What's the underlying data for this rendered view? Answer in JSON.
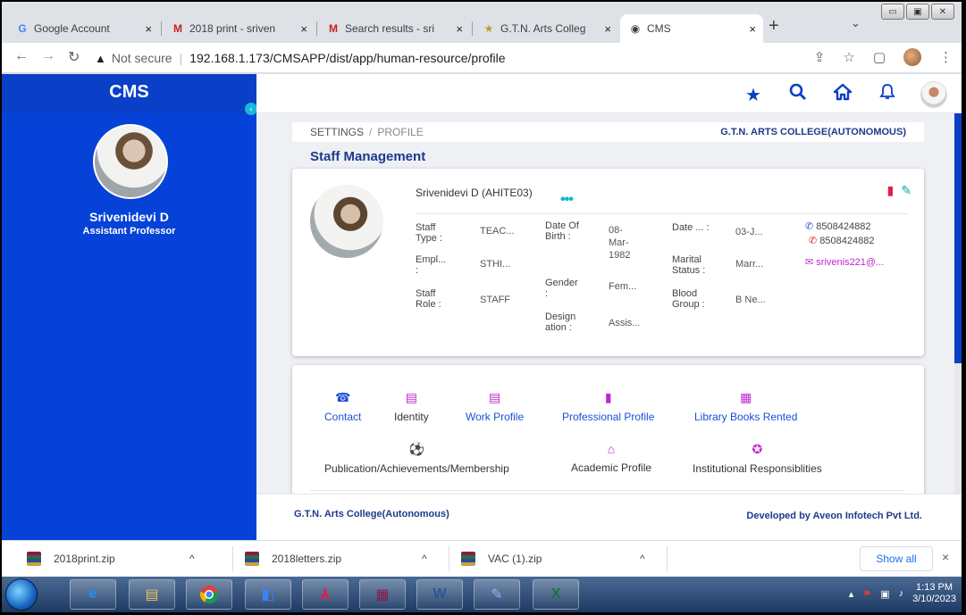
{
  "browser": {
    "tabs": [
      {
        "label": "Google Account",
        "favicon": "G",
        "color": "#4285f4"
      },
      {
        "label": "2018 print - sriven",
        "favicon": "M",
        "color": "#c5221f"
      },
      {
        "label": "Search results - sri",
        "favicon": "M",
        "color": "#c5221f"
      },
      {
        "label": "G.T.N. Arts Colleg",
        "favicon": "★",
        "color": "#c29a2a"
      },
      {
        "label": "CMS",
        "favicon": "◉",
        "color": "#3c4043"
      }
    ],
    "close_glyph": "×",
    "newtab_glyph": "+",
    "tabctrl_glyph": "⌄",
    "address": {
      "warning": "▲",
      "not_secure": "Not secure",
      "divider": "|",
      "url": "192.168.1.173/CMSAPP/dist/app/human-resource/profile"
    }
  },
  "app": {
    "brand": "CMS",
    "sidebar": {
      "name": "Srivenidevi D",
      "role": "Assistant Professor"
    },
    "breadcrumb": {
      "settings": "SETTINGS",
      "sep": "/",
      "profile": "PROFILE",
      "college": "G.T.N. ARTS COLLEGE(AUTONOMOUS)"
    },
    "section_title": "Staff Management",
    "staff": {
      "name": "Srivenidevi D (AHITE03)",
      "dots": "•••",
      "fields": {
        "staff_type_label": "Staff Type :",
        "staff_type_value": "TEAC...",
        "dob_label": "Date Of Birth :",
        "dob_value": "08-Mar-1982",
        "date_label": "Date ... :",
        "date_value": "03-J...",
        "emp_label": "Empl... :",
        "emp_value": "STHI...",
        "gender_label": "Gender :",
        "gender_value": "Fem...",
        "marital_label": "Marital Status :",
        "marital_value": "Marr...",
        "role_label": "Staff Role :",
        "role_value": "STAFF",
        "blood_label": "Blood Group :",
        "blood_value": "B Ne...",
        "desig_label": "Design ation :",
        "desig_value": "Assis..."
      },
      "phone1": "8508424882",
      "phone2": "8508424882",
      "email": "srivenis221@..."
    },
    "profile_nav": [
      {
        "label": "Contact",
        "icon": "phone-icon",
        "glyph": "☎",
        "color": "#1d4ed8"
      },
      {
        "label": "Identity",
        "icon": "id-card-icon",
        "glyph": "▤",
        "color": "#c026d3"
      },
      {
        "label": "Work Profile",
        "icon": "work-icon",
        "glyph": "▤",
        "color": "#c026d3"
      },
      {
        "label": "Professional Profile",
        "icon": "document-icon",
        "glyph": "▮",
        "color": "#c026d3"
      },
      {
        "label": "Library Books Rented",
        "icon": "book-icon",
        "glyph": "▦",
        "color": "#c026d3"
      },
      {
        "label": "Publication/Achievements/Membership",
        "icon": "soccer-ball-icon",
        "glyph": "⚽",
        "color": "#c026d3"
      },
      {
        "label": "Academic Profile",
        "icon": "bank-icon",
        "glyph": "⌂",
        "color": "#c026d3"
      },
      {
        "label": "Institutional Responsiblities",
        "icon": "award-icon",
        "glyph": "✪",
        "color": "#c026d3"
      }
    ],
    "footer": {
      "left": "G.T.N. Arts College(Autonomous)",
      "right": "Developed by Aveon Infotech Pvt Ltd."
    }
  },
  "downloads": {
    "items": [
      "2018print.zip",
      "2018letters.zip",
      "VAC (1).zip"
    ],
    "chevron": "^",
    "show_all": "Show all",
    "close": "×"
  },
  "taskbar": {
    "time": "1:13 PM",
    "date": "3/10/2023"
  },
  "colors": {
    "sidebar": "#0642d7",
    "accent": "#0a3fc7",
    "heading": "#1e3a8a"
  }
}
